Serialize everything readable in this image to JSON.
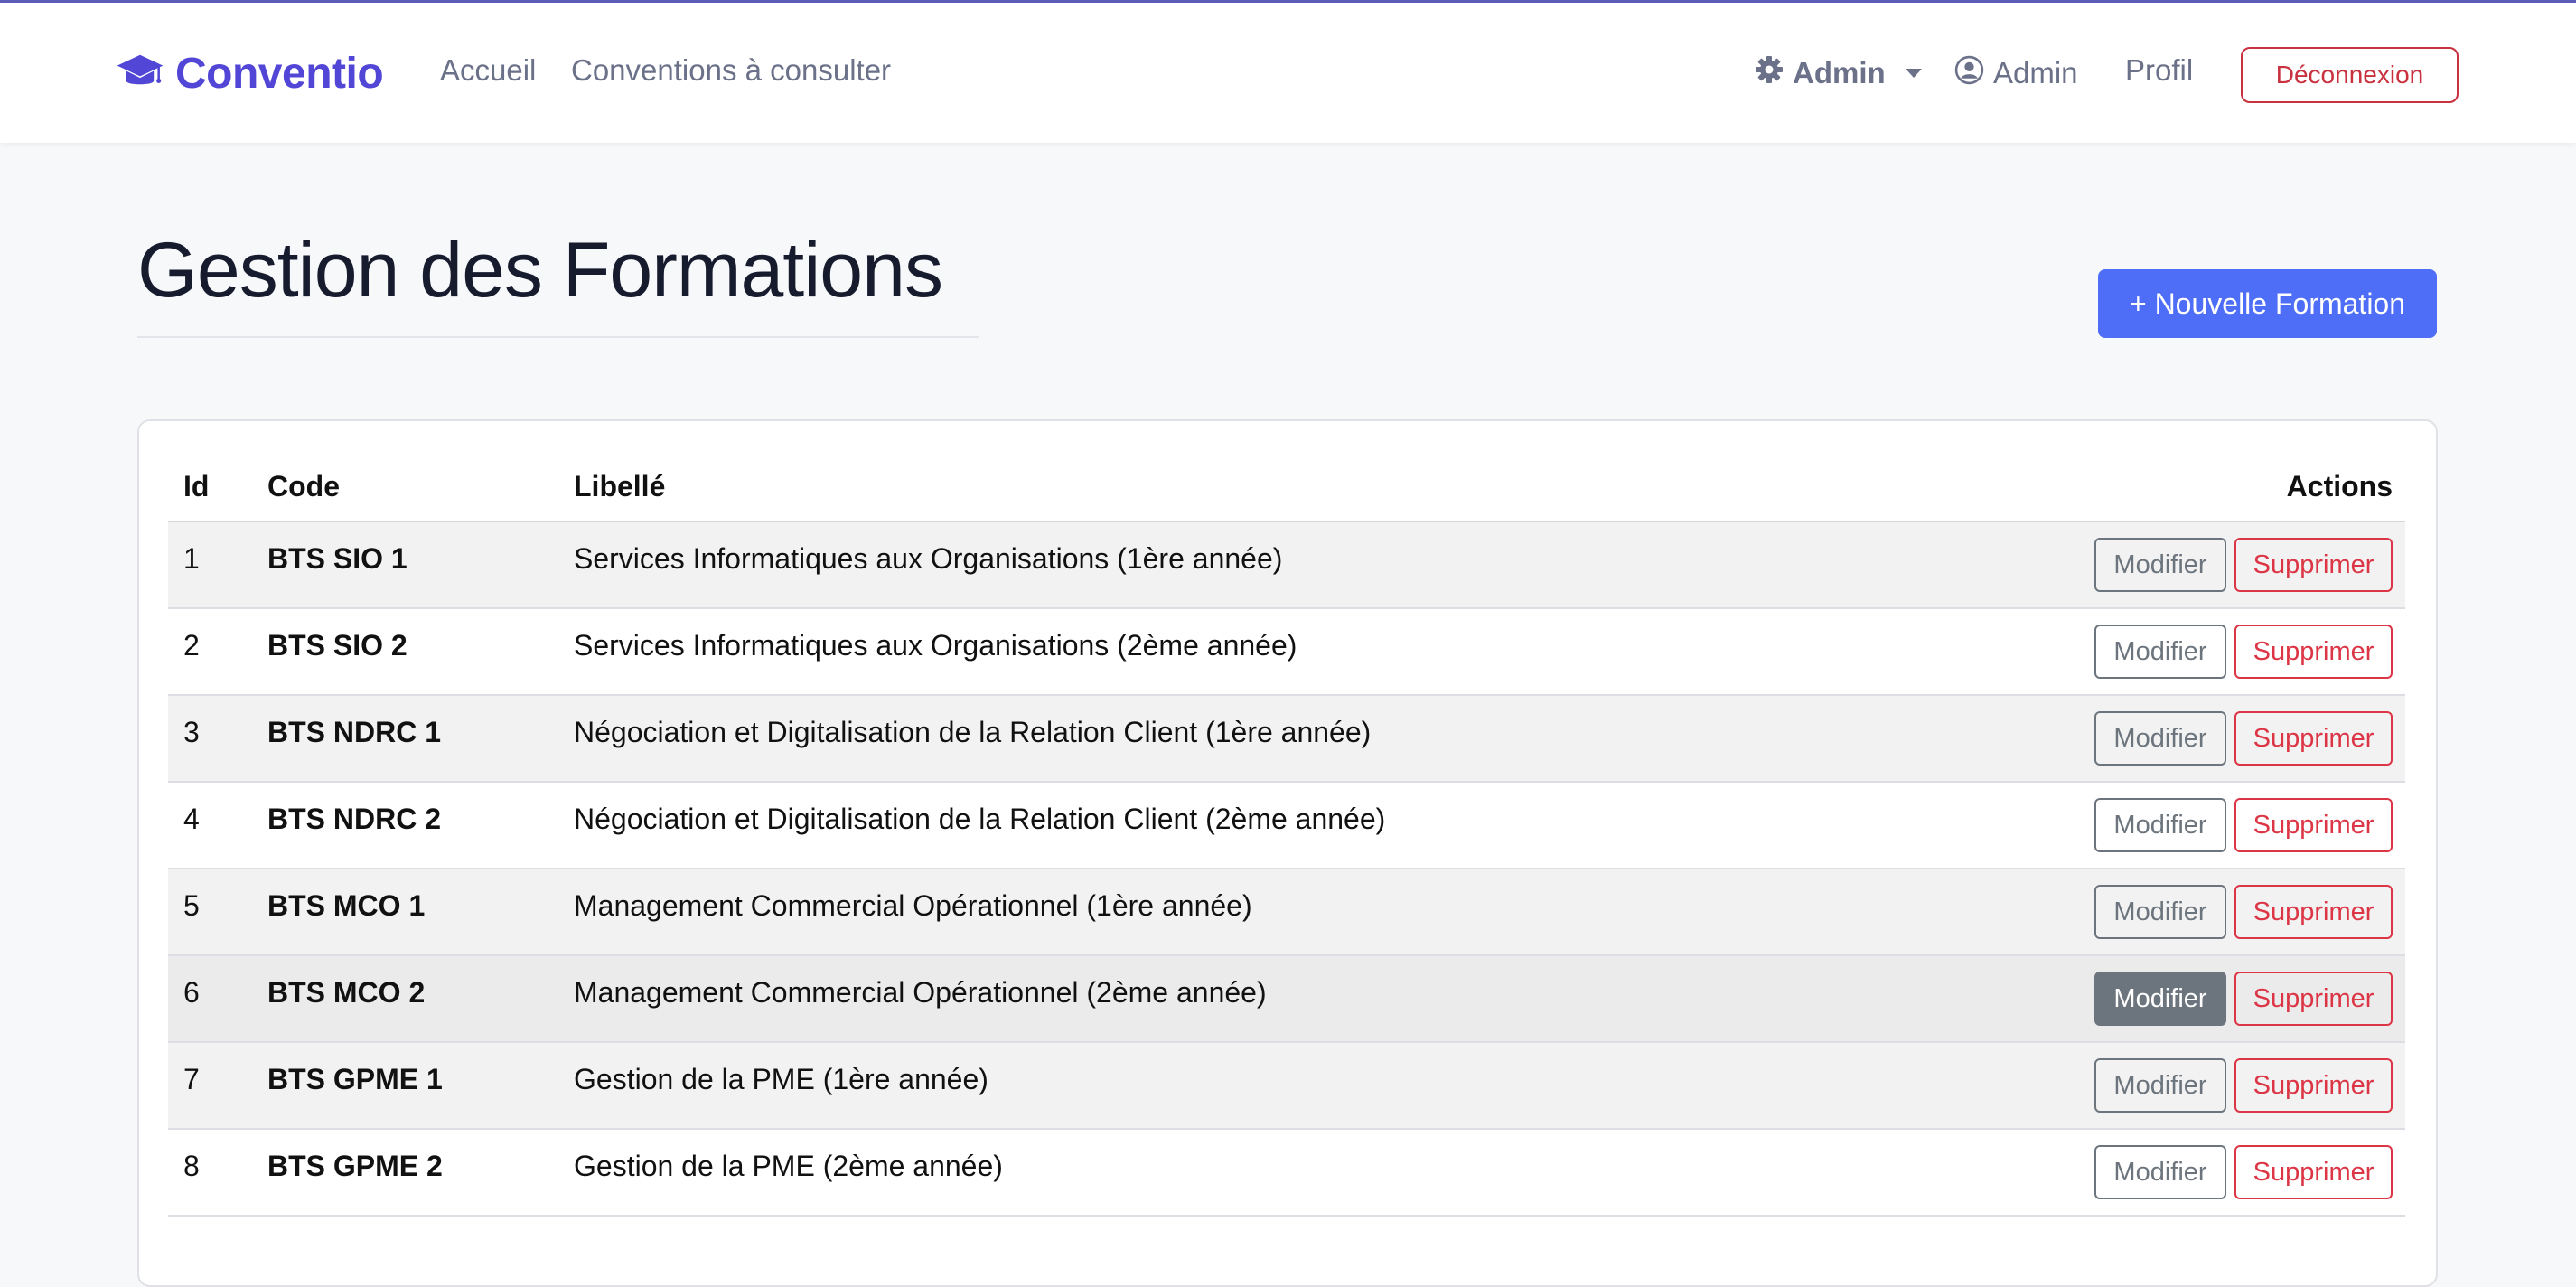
{
  "navbar": {
    "brand": "Conventio",
    "links": [
      "Accueil",
      "Conventions à consulter"
    ],
    "admin_menu": "Admin",
    "user": "Admin",
    "profile": "Profil",
    "logout": "Déconnexion"
  },
  "page": {
    "title": "Gestion des Formations",
    "new_button": "+ Nouvelle Formation"
  },
  "table": {
    "headers": {
      "id": "Id",
      "code": "Code",
      "label": "Libellé",
      "actions": "Actions"
    },
    "edit_label": "Modifier",
    "delete_label": "Supprimer",
    "rows": [
      {
        "id": "1",
        "code": "BTS SIO 1",
        "label": "Services Informatiques aux Organisations (1ère année)"
      },
      {
        "id": "2",
        "code": "BTS SIO 2",
        "label": "Services Informatiques aux Organisations (2ème année)"
      },
      {
        "id": "3",
        "code": "BTS NDRC 1",
        "label": "Négociation et Digitalisation de la Relation Client (1ère année)"
      },
      {
        "id": "4",
        "code": "BTS NDRC 2",
        "label": "Négociation et Digitalisation de la Relation Client (2ème année)"
      },
      {
        "id": "5",
        "code": "BTS MCO 1",
        "label": "Management Commercial Opérationnel (1ère année)"
      },
      {
        "id": "6",
        "code": "BTS MCO 2",
        "label": "Management Commercial Opérationnel (2ème année)"
      },
      {
        "id": "7",
        "code": "BTS GPME 1",
        "label": "Gestion de la PME (1ère année)"
      },
      {
        "id": "8",
        "code": "BTS GPME 2",
        "label": "Gestion de la PME (2ème année)"
      }
    ]
  },
  "colors": {
    "brand": "#5146d6",
    "primary": "#4f6ef7",
    "danger": "#dc3545",
    "secondary": "#6c757d"
  },
  "icons": [
    "graduation-cap-icon",
    "gear-icon",
    "user-circle-icon"
  ]
}
